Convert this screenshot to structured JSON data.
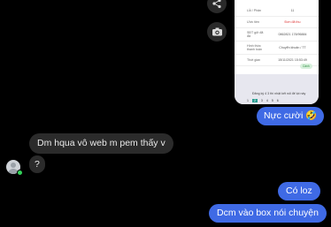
{
  "shared_screenshot": {
    "rows": [
      {
        "label": "Lỗi / Phân",
        "value": "11"
      },
      {
        "label": "Ước tiền",
        "value": "Đơn đã thu"
      },
      {
        "label": "SĐT gửi đã đã",
        "value": "0862821 178/96884"
      },
      {
        "label": "Hình thức thanh toán",
        "value": "Chuyển khoản / TT"
      },
      {
        "label": "Thời gian",
        "value": "15/11/2021 15:53:49"
      }
    ],
    "red_chip": "Tiền",
    "green_chip": "Cảnh",
    "keyboard_preview": "Đăng ký 4 3 thì nhật kết nối đế lọt này",
    "keyboard_nums": [
      "1",
      "2",
      "3",
      "4",
      "5",
      "6"
    ]
  },
  "messages": {
    "sent_1": "Nực cười 🤣",
    "recv_1": "Dm hqua vô web m pem thấy v",
    "recv_2": "?",
    "sent_2": "Có loz",
    "sent_3": "Dcm vào box nói chuyện"
  },
  "colors": {
    "sent_bubble": "#3f6ae5",
    "recv_bubble": "#2b2b2b",
    "online": "#31d158"
  },
  "icons": {
    "share": "share-icon",
    "camera": "camera-icon"
  }
}
